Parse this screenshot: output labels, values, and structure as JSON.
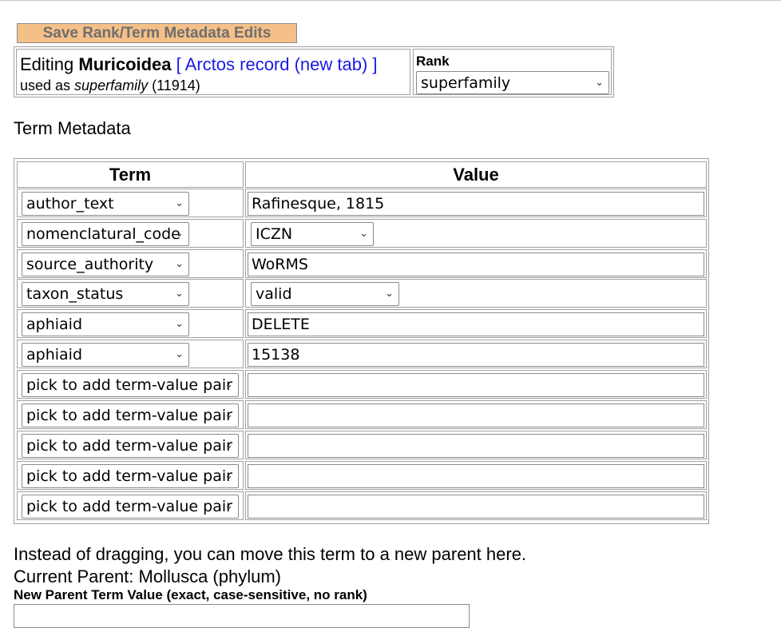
{
  "toolbar": {
    "save_label": "Save Rank/Term Metadata Edits"
  },
  "header": {
    "editing_prefix": "Editing ",
    "term_name": "Muricoidea",
    "arctos_link": "[ Arctos record (new tab) ]",
    "used_as_prefix": "used as ",
    "used_as_rank": "superfamily",
    "used_as_count": " (11914)",
    "rank_label": "Rank",
    "rank_value": "superfamily"
  },
  "metadata": {
    "title": "Term Metadata",
    "col_term": "Term",
    "col_value": "Value",
    "rows": [
      {
        "term": "author_text",
        "value": "Rafinesque, 1815",
        "value_kind": "text"
      },
      {
        "term": "nomenclatural_code",
        "value": "ICZN",
        "value_kind": "select"
      },
      {
        "term": "source_authority",
        "value": "WoRMS",
        "value_kind": "text"
      },
      {
        "term": "taxon_status",
        "value": "valid",
        "value_kind": "select"
      },
      {
        "term": "aphiaid",
        "value": "DELETE",
        "value_kind": "text"
      },
      {
        "term": "aphiaid",
        "value": "15138",
        "value_kind": "text"
      },
      {
        "term": "pick to add term-value pair",
        "value": "",
        "value_kind": "text"
      },
      {
        "term": "pick to add term-value pair",
        "value": "",
        "value_kind": "text"
      },
      {
        "term": "pick to add term-value pair",
        "value": "",
        "value_kind": "text"
      },
      {
        "term": "pick to add term-value pair",
        "value": "",
        "value_kind": "text"
      },
      {
        "term": "pick to add term-value pair",
        "value": "",
        "value_kind": "text"
      }
    ]
  },
  "move": {
    "instructions": "Instead of dragging, you can move this term to a new parent here.",
    "current_parent": "Current Parent: Mollusca (phylum)",
    "new_parent_label": "New Parent Term Value (exact, case-sensitive, no rank)",
    "new_parent_value": ""
  },
  "icons": {
    "dropdown": "chevron-down-icon"
  }
}
